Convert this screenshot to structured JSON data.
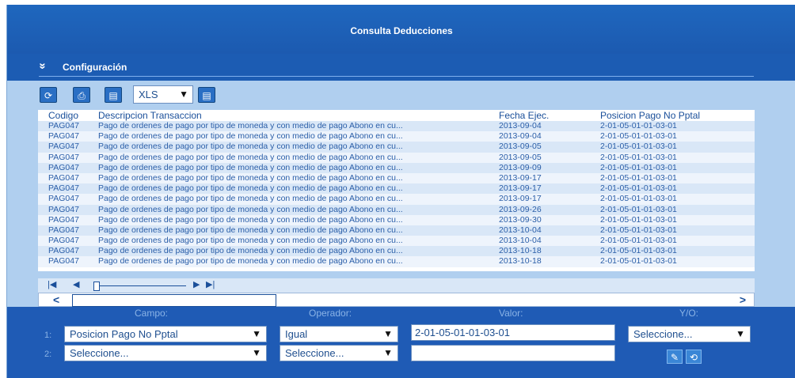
{
  "window": {
    "title": "Consulta Deducciones"
  },
  "config": {
    "label": "Configuración"
  },
  "toolbar": {
    "export_format": "XLS"
  },
  "grid": {
    "columns": [
      "Codigo",
      "Descripcion Transaccion",
      "Fecha Ejec.",
      "Posicion Pago No Pptal"
    ],
    "rows": [
      [
        "PAG047",
        "Pago de ordenes de pago por tipo de moneda y con medio de pago Abono en cu...",
        "2013-09-04",
        "2-01-05-01-01-03-01"
      ],
      [
        "PAG047",
        "Pago de ordenes de pago por tipo de moneda y con medio de pago Abono en cu...",
        "2013-09-04",
        "2-01-05-01-01-03-01"
      ],
      [
        "PAG047",
        "Pago de ordenes de pago por tipo de moneda y con medio de pago Abono en cu...",
        "2013-09-05",
        "2-01-05-01-01-03-01"
      ],
      [
        "PAG047",
        "Pago de ordenes de pago por tipo de moneda y con medio de pago Abono en cu...",
        "2013-09-05",
        "2-01-05-01-01-03-01"
      ],
      [
        "PAG047",
        "Pago de ordenes de pago por tipo de moneda y con medio de pago Abono en cu...",
        "2013-09-09",
        "2-01-05-01-01-03-01"
      ],
      [
        "PAG047",
        "Pago de ordenes de pago por tipo de moneda y con medio de pago Abono en cu...",
        "2013-09-17",
        "2-01-05-01-01-03-01"
      ],
      [
        "PAG047",
        "Pago de ordenes de pago por tipo de moneda y con medio de pago Abono en cu...",
        "2013-09-17",
        "2-01-05-01-01-03-01"
      ],
      [
        "PAG047",
        "Pago de ordenes de pago por tipo de moneda y con medio de pago Abono en cu...",
        "2013-09-17",
        "2-01-05-01-01-03-01"
      ],
      [
        "PAG047",
        "Pago de ordenes de pago por tipo de moneda y con medio de pago Abono en cu...",
        "2013-09-26",
        "2-01-05-01-01-03-01"
      ],
      [
        "PAG047",
        "Pago de ordenes de pago por tipo de moneda y con medio de pago Abono en cu...",
        "2013-09-30",
        "2-01-05-01-01-03-01"
      ],
      [
        "PAG047",
        "Pago de ordenes de pago por tipo de moneda y con medio de pago Abono en cu...",
        "2013-10-04",
        "2-01-05-01-01-03-01"
      ],
      [
        "PAG047",
        "Pago de ordenes de pago por tipo de moneda y con medio de pago Abono en cu...",
        "2013-10-04",
        "2-01-05-01-01-03-01"
      ],
      [
        "PAG047",
        "Pago de ordenes de pago por tipo de moneda y con medio de pago Abono en cu...",
        "2013-10-18",
        "2-01-05-01-01-03-01"
      ],
      [
        "PAG047",
        "Pago de ordenes de pago por tipo de moneda y con medio de pago Abono en cu...",
        "2013-10-18",
        "2-01-05-01-01-03-01"
      ]
    ]
  },
  "filters": {
    "headers": {
      "campo": "Campo:",
      "operador": "Operador:",
      "valor": "Valor:",
      "yo": "Y/O:"
    },
    "rows": [
      {
        "num": "1:",
        "campo": "Posicion Pago No Pptal",
        "operador": "Igual",
        "valor": "2-01-05-01-01-03-01",
        "yo": "Seleccione..."
      },
      {
        "num": "2:",
        "campo": "Seleccione...",
        "operador": "Seleccione...",
        "valor": ""
      }
    ]
  },
  "icons": {
    "refresh": "refresh-icon",
    "print": "print-icon",
    "save": "save-icon",
    "export": "export-icon",
    "pager_first": "first-page-icon",
    "pager_prev": "prev-page-icon",
    "pager_next": "next-page-icon",
    "pager_last": "last-page-icon",
    "apply": "apply-filter-icon",
    "clear": "clear-filter-icon"
  }
}
